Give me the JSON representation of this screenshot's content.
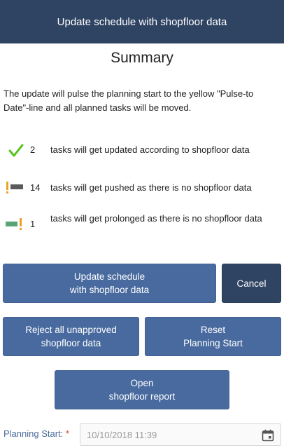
{
  "header": {
    "title": "Update schedule with shopfloor data"
  },
  "summary": {
    "title": "Summary",
    "description": "The update will pulse the planning start to the yellow \"Pulse-to Date\"-line and all planned tasks will be moved."
  },
  "items": [
    {
      "icon": "check-icon",
      "count": "2",
      "text": "tasks will get updated according to shopfloor data"
    },
    {
      "icon": "pushed-bar-icon",
      "count": "14",
      "text": "tasks will get pushed as there is no shopfloor data"
    },
    {
      "icon": "prolonged-bar-icon",
      "count": "1",
      "text": "tasks will get prolonged as there is no shopfloor data"
    }
  ],
  "buttons": {
    "update": [
      "Update schedule",
      "with shopfloor data"
    ],
    "cancel": "Cancel",
    "reject": [
      "Reject all unapproved",
      "shopfloor data"
    ],
    "reset": [
      "Reset",
      "Planning Start"
    ],
    "report": [
      "Open",
      "shopfloor report"
    ]
  },
  "planning_start": {
    "label": "Planning Start:",
    "required_mark": "*",
    "value": "10/10/2018 11:39",
    "icon": "calendar-icon"
  },
  "colors": {
    "header": "#2f4463",
    "button": "#486a9f",
    "button_dark": "#2f4463",
    "check": "#52c41a",
    "warning": "#f0a020",
    "pushed_bar": "#5a5a5a",
    "prolonged_bar": "#5aa576"
  }
}
